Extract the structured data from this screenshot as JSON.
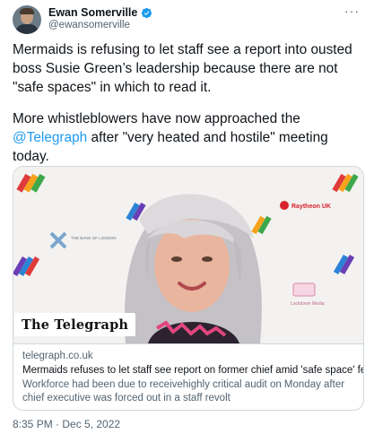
{
  "author": {
    "name": "Ewan Somerville",
    "handle": "@ewansomerville",
    "verified": true
  },
  "more_icon": "more-horizontal-icon",
  "tweet": {
    "paragraph1": "Mermaids is refusing to let staff see a report into ousted boss Susie Green’s leadership because there are not \"safe spaces\" in which to read it.",
    "paragraph2_before": "More whistleblowers have now approached the ",
    "paragraph2_mention": "@Telegraph",
    "paragraph2_after": " after \"very heated and hostile\" meeting today."
  },
  "link_card": {
    "source_label": "The Telegraph",
    "domain": "telegraph.co.uk",
    "title": "Mermaids refuses to let staff see report on former chief amid 'safe space' fears",
    "description": "Workforce had been due to receivehighly critical audit on Monday after chief executive was forced out in a staff revolt",
    "backdrop_logos": [
      "THE BANK OF LONDON",
      "Raytheon UK",
      "Lockdown Media"
    ]
  },
  "timestamp": "8:35 PM · Dec 5, 2022",
  "colors": {
    "link": "#1d9bf0",
    "text": "#0f1419",
    "muted": "#536471",
    "border": "#cfd9de"
  }
}
